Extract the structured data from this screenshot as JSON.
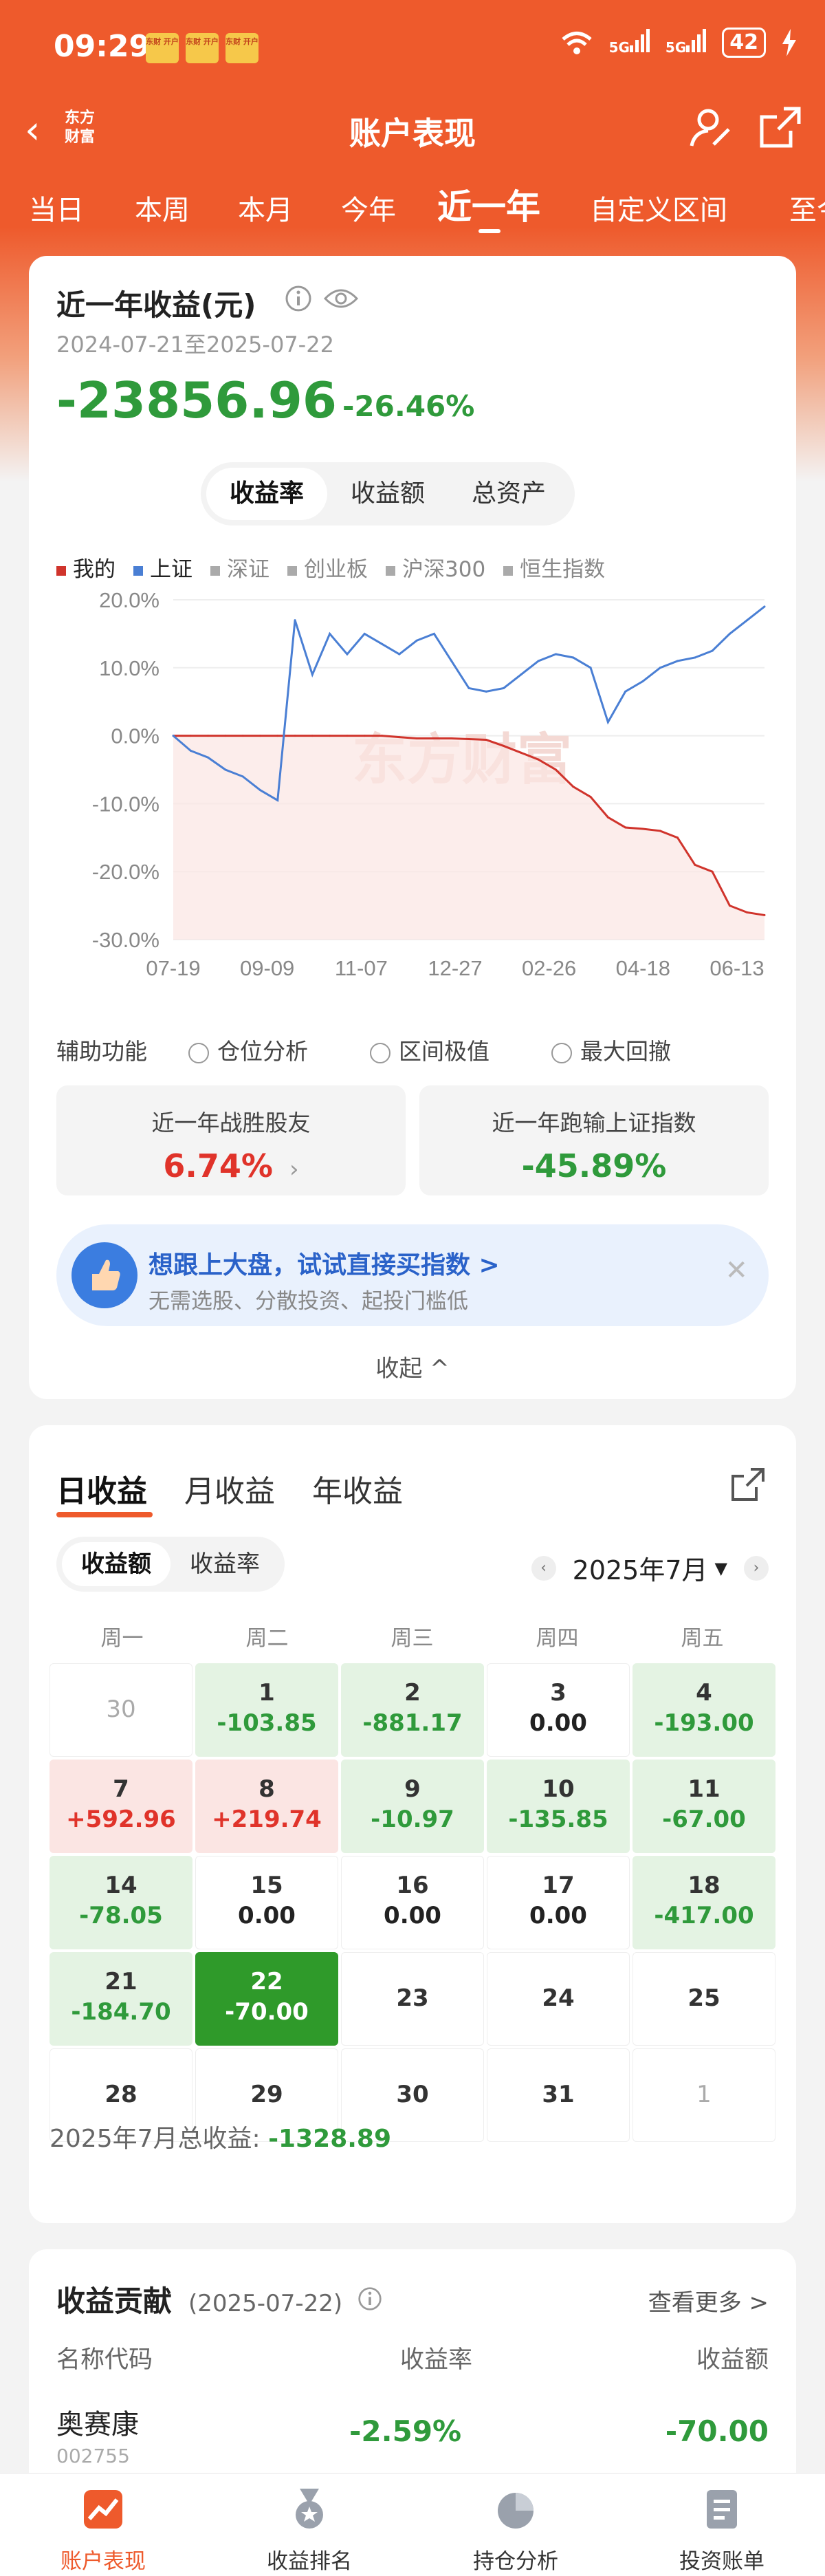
{
  "status": {
    "time": "09:29",
    "badges": [
      "东财\n开户",
      "东财\n开户",
      "东财\n开户"
    ],
    "signal_a": "5G",
    "signal_b": "5G",
    "battery": "42"
  },
  "nav": {
    "back": "‹",
    "logo": "东方\n财富",
    "title": "账户表现"
  },
  "periods": [
    "当日",
    "本周",
    "本月",
    "今年",
    "近一年",
    "自定义区间",
    "至今"
  ],
  "summary": {
    "title": "近一年收益(元)",
    "date_range": "2024-07-21至2025-07-22",
    "amount": "-23856.96",
    "rate": "-26.46%",
    "seg": [
      "收益率",
      "收益额",
      "总资产"
    ],
    "legend": [
      {
        "label": "我的",
        "color": "#d0342c"
      },
      {
        "label": "上证",
        "color": "#4a7fd4"
      },
      {
        "label": "深证",
        "color": "#aaaaaa"
      },
      {
        "label": "创业板",
        "color": "#aaaaaa"
      },
      {
        "label": "沪深300",
        "color": "#aaaaaa"
      },
      {
        "label": "恒生指数",
        "color": "#aaaaaa"
      }
    ],
    "watermark": "东方财富",
    "aux_label": "辅助功能",
    "aux_options": [
      "仓位分析",
      "区间极值",
      "最大回撤"
    ],
    "stat1_label": "近一年战胜股友",
    "stat1_value": "6.74%",
    "stat2_label": "近一年跑输上证指数",
    "stat2_value": "-45.89%",
    "promo_title": "想跟上大盘，试试直接买指数 >",
    "promo_sub": "无需选股、分散投资、起投门槛低",
    "collapse": "收起 ^"
  },
  "chart_data": {
    "type": "line",
    "ylim": [
      -30,
      20
    ],
    "y_ticks": [
      "20.0%",
      "10.0%",
      "0.0%",
      "-10.0%",
      "-20.0%",
      "-30.0%"
    ],
    "x_ticks": [
      "07-19",
      "09-09",
      "11-07",
      "12-27",
      "02-26",
      "04-18",
      "06-13"
    ],
    "series": [
      {
        "name": "我的",
        "color": "#d0342c",
        "values": [
          0,
          0,
          0,
          0,
          0,
          0,
          0,
          0,
          0,
          0,
          0,
          0,
          0,
          -0.2,
          -0.4,
          -0.4,
          -0.4,
          -0.5,
          -0.6,
          -1.5,
          -2.5,
          -3.5,
          -5,
          -7.5,
          -9,
          -12,
          -13.5,
          -13.7,
          -14,
          -15,
          -19,
          -20,
          -25,
          -26,
          -26.4
        ]
      },
      {
        "name": "上证",
        "color": "#4a7fd4",
        "values": [
          0,
          -2.2,
          -3.2,
          -5,
          -6,
          -8,
          -9.5,
          17,
          9,
          15,
          12,
          15,
          13.5,
          12,
          14,
          15,
          11,
          7,
          6.5,
          7,
          9,
          11,
          12,
          11.5,
          10,
          2,
          6.5,
          8,
          10,
          11,
          11.5,
          12.5,
          15,
          17,
          19
        ]
      }
    ]
  },
  "daily": {
    "tabs": [
      "日收益",
      "月收益",
      "年收益"
    ],
    "seg": [
      "收益额",
      "收益率"
    ],
    "month": "2025年7月",
    "weekdays": [
      "周一",
      "周二",
      "周三",
      "周四",
      "周五"
    ],
    "cells": [
      {
        "d": "30",
        "v": "",
        "t": "dim"
      },
      {
        "d": "1",
        "v": "-103.85",
        "t": "gn"
      },
      {
        "d": "2",
        "v": "-881.17",
        "t": "gn"
      },
      {
        "d": "3",
        "v": "0.00",
        "t": "wh"
      },
      {
        "d": "4",
        "v": "-193.00",
        "t": "gn"
      },
      {
        "d": "7",
        "v": "+592.96",
        "t": "rd"
      },
      {
        "d": "8",
        "v": "+219.74",
        "t": "rd"
      },
      {
        "d": "9",
        "v": "-10.97",
        "t": "gn"
      },
      {
        "d": "10",
        "v": "-135.85",
        "t": "gn"
      },
      {
        "d": "11",
        "v": "-67.00",
        "t": "gn"
      },
      {
        "d": "14",
        "v": "-78.05",
        "t": "gn"
      },
      {
        "d": "15",
        "v": "0.00",
        "t": "wh"
      },
      {
        "d": "16",
        "v": "0.00",
        "t": "wh"
      },
      {
        "d": "17",
        "v": "0.00",
        "t": "wh"
      },
      {
        "d": "18",
        "v": "-417.00",
        "t": "gn"
      },
      {
        "d": "21",
        "v": "-184.70",
        "t": "gn"
      },
      {
        "d": "22",
        "v": "-70.00",
        "t": "sel"
      },
      {
        "d": "23",
        "v": "",
        "t": "plain"
      },
      {
        "d": "24",
        "v": "",
        "t": "plain"
      },
      {
        "d": "25",
        "v": "",
        "t": "plain"
      },
      {
        "d": "28",
        "v": "",
        "t": "plain"
      },
      {
        "d": "29",
        "v": "",
        "t": "plain"
      },
      {
        "d": "30",
        "v": "",
        "t": "plain"
      },
      {
        "d": "31",
        "v": "",
        "t": "plain"
      },
      {
        "d": "1",
        "v": "",
        "t": "dim"
      }
    ],
    "total_label": "2025年7月总收益: ",
    "total_value": "-1328.89"
  },
  "contrib": {
    "title": "收益贡献",
    "date": "(2025-07-22)",
    "more": "查看更多 >",
    "col_name": "名称代码",
    "col_rate": "收益率",
    "col_amount": "收益额",
    "row": {
      "name": "奥赛康",
      "code": "002755",
      "rate": "-2.59%",
      "amount": "-70.00"
    }
  },
  "bottom_nav": [
    "账户表现",
    "收益排名",
    "持仓分析",
    "投资账单"
  ]
}
